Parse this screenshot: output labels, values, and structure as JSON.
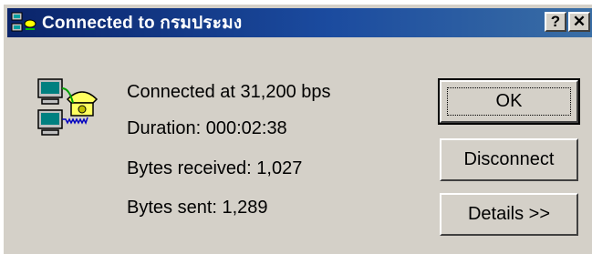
{
  "window": {
    "title": "Connected to กรมประมง",
    "help_label": "?",
    "close_label": "✕"
  },
  "info": {
    "connected": "Connected at 31,200 bps",
    "duration": "Duration:  000:02:38",
    "received": "Bytes received:  1,027",
    "sent": "Bytes sent:  1,289"
  },
  "buttons": {
    "ok": "OK",
    "disconnect": "Disconnect",
    "details": "Details >>"
  },
  "icons": {
    "title": "dialup-connection-icon",
    "main": "computers-phone-connection-icon"
  }
}
